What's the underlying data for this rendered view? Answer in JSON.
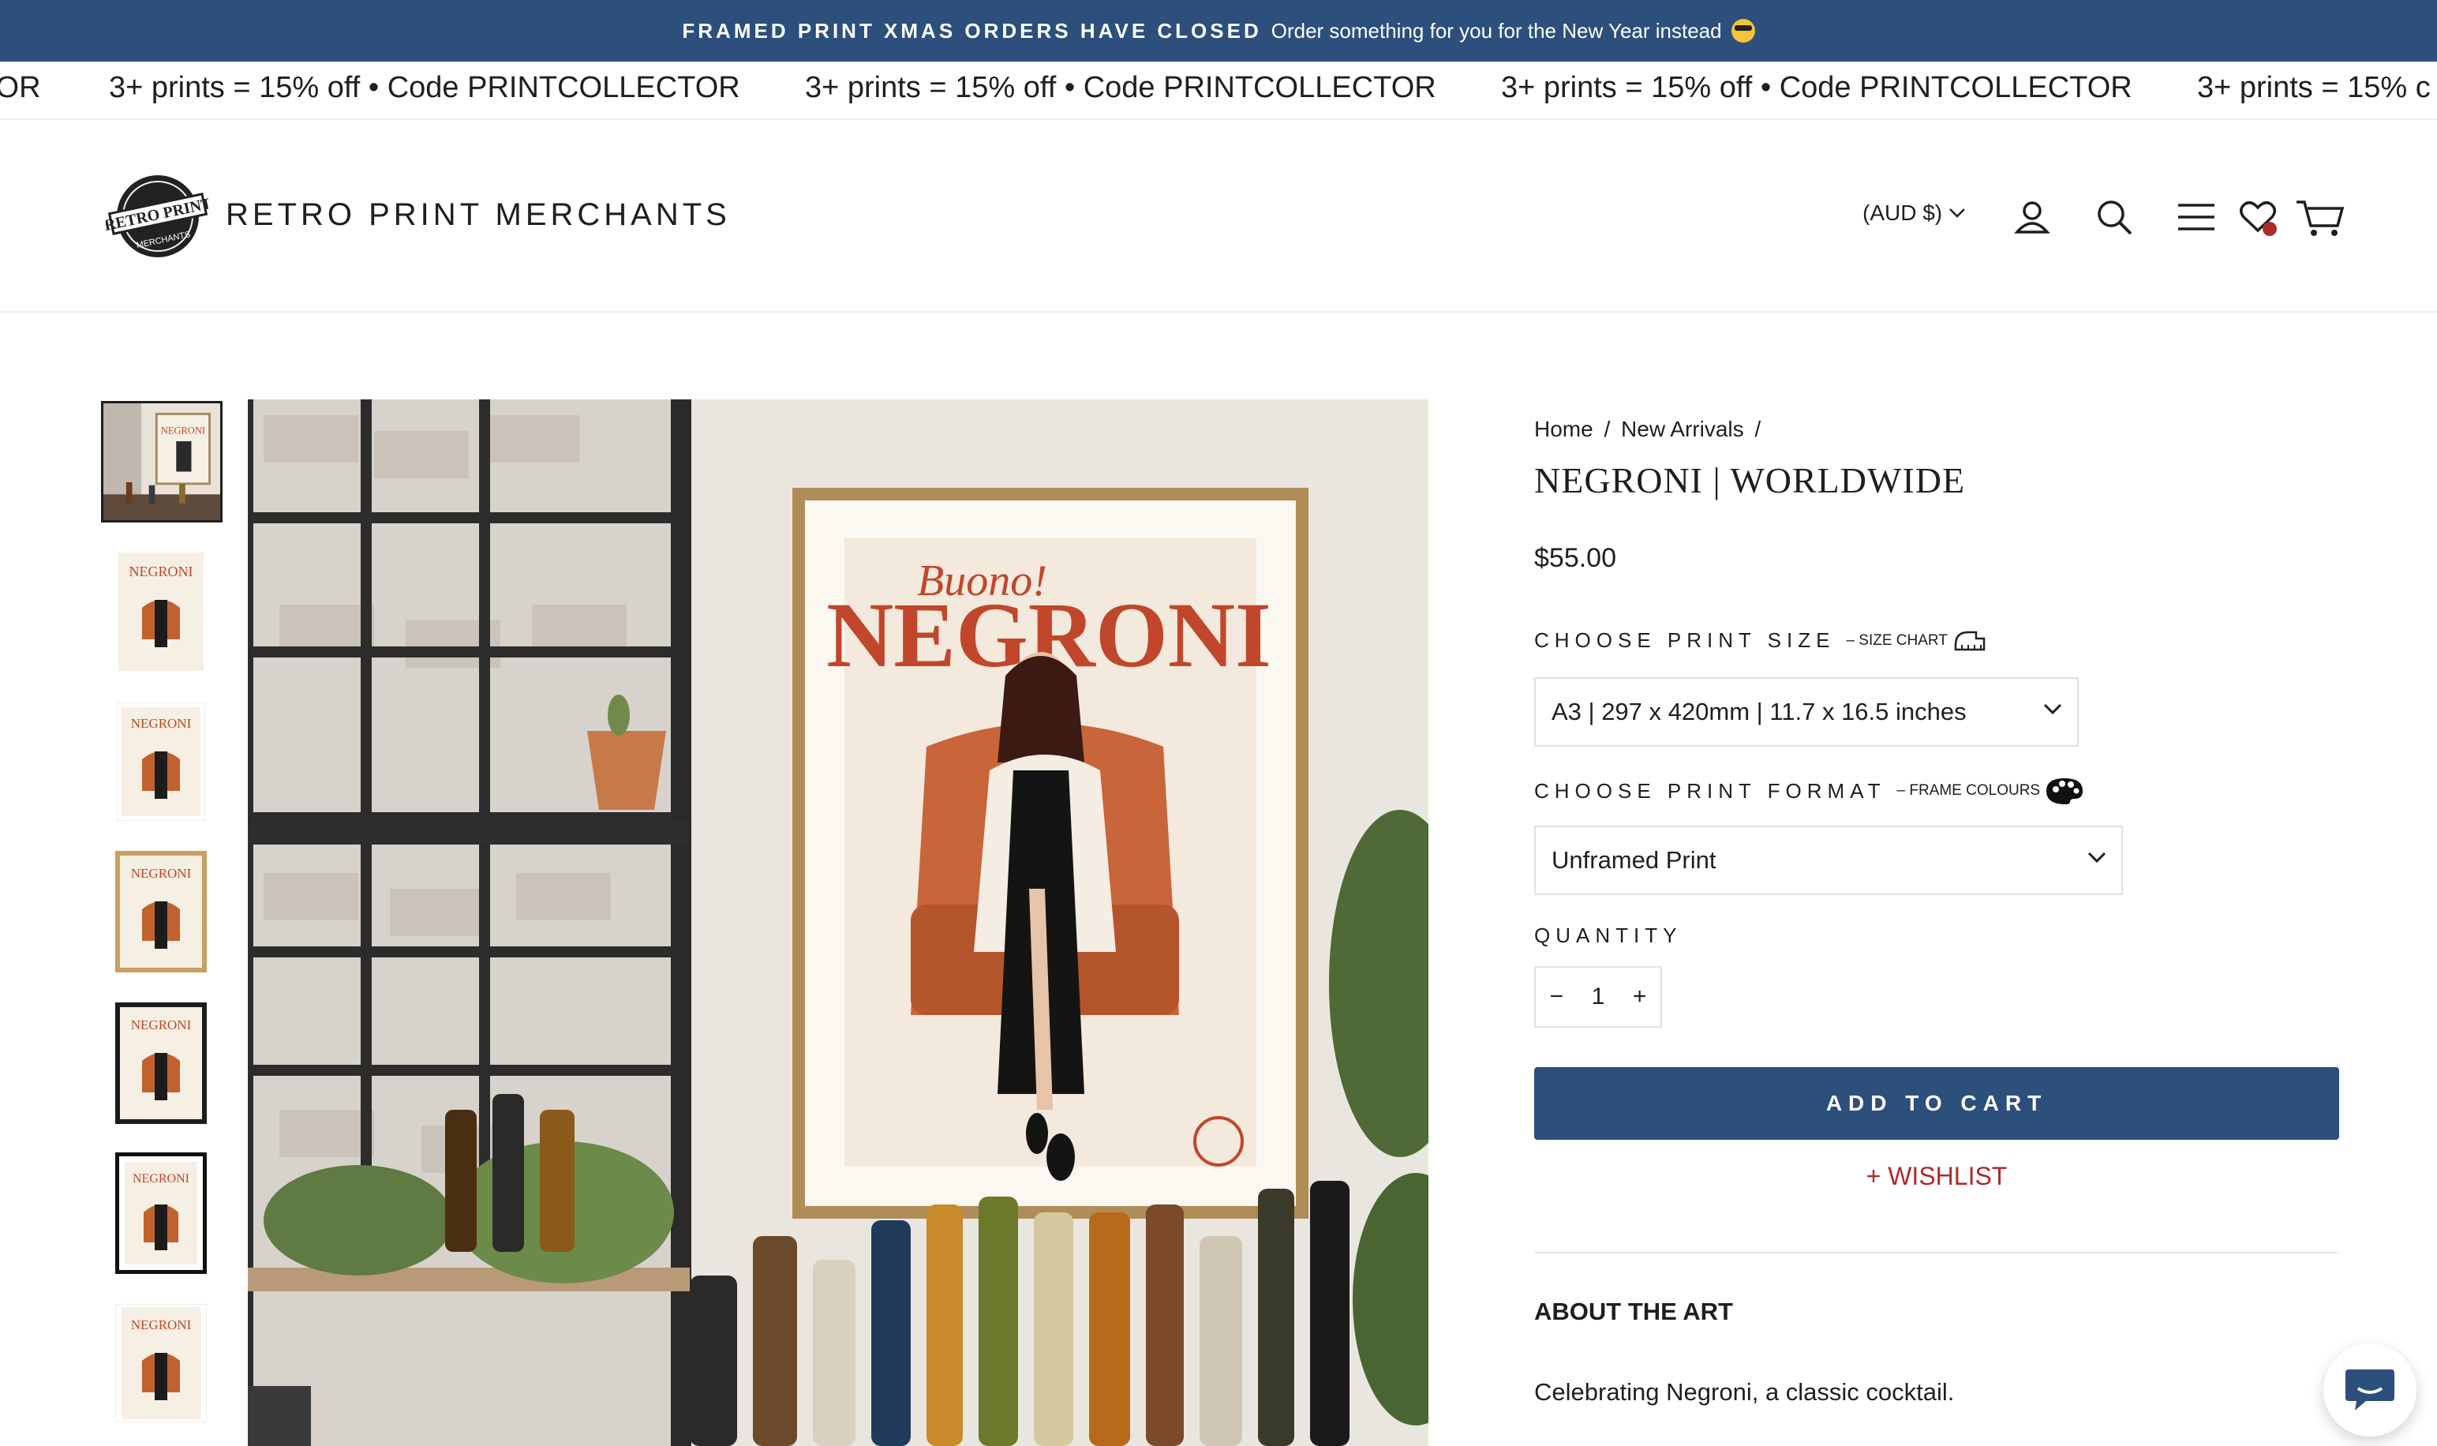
{
  "announcement": {
    "bold_text": "FRAMED PRINT XMAS ORDERS HAVE CLOSED",
    "text": "Order something for you for the New Year instead",
    "emoji_icon": "sunglasses-face-emoji"
  },
  "marquee": {
    "items": [
      "TOR",
      "3+ prints = 15% off • Code PRINTCOLLECTOR",
      "3+ prints = 15% off • Code PRINTCOLLECTOR",
      "3+ prints = 15% off • Code PRINTCOLLECTOR",
      "3+ prints = 15% c"
    ]
  },
  "header": {
    "logo_badge_text": "RETRO PRINT",
    "logo_badge_subtext": "MERCHANTS",
    "brand_name": "RETRO PRINT MERCHANTS",
    "currency": "(AUD $)",
    "icons": [
      "account-icon",
      "search-icon",
      "menu-icon",
      "wishlist-heart-icon",
      "cart-icon"
    ]
  },
  "gallery": {
    "thumbnail_count": 7,
    "poster_script": "Buono!",
    "poster_title": "NEGRONI"
  },
  "product": {
    "breadcrumb": [
      "Home",
      "/",
      "New Arrivals",
      "/"
    ],
    "title": "NEGRONI | WORLDWIDE",
    "price": "$55.00",
    "size_label": "CHOOSE PRINT SIZE",
    "size_chart_link": "– SIZE CHART",
    "size_value": "A3 | 297 x 420mm | 11.7 x 16.5 inches",
    "format_label": "CHOOSE PRINT FORMAT",
    "frame_colours_link": "– FRAME COLOURS",
    "format_value": "Unframed Print",
    "quantity_label": "QUANTITY",
    "quantity_minus": "−",
    "quantity_value": "1",
    "quantity_plus": "+",
    "add_to_cart": "ADD TO CART",
    "wishlist": "+ WISHLIST",
    "about_heading": "ABOUT THE ART",
    "about_text": "Celebrating Negroni, a classic cocktail."
  },
  "colors": {
    "brand_blue": "#2c4f7c",
    "wishlist_red": "#b02a2a",
    "poster_red": "#c0472b"
  }
}
